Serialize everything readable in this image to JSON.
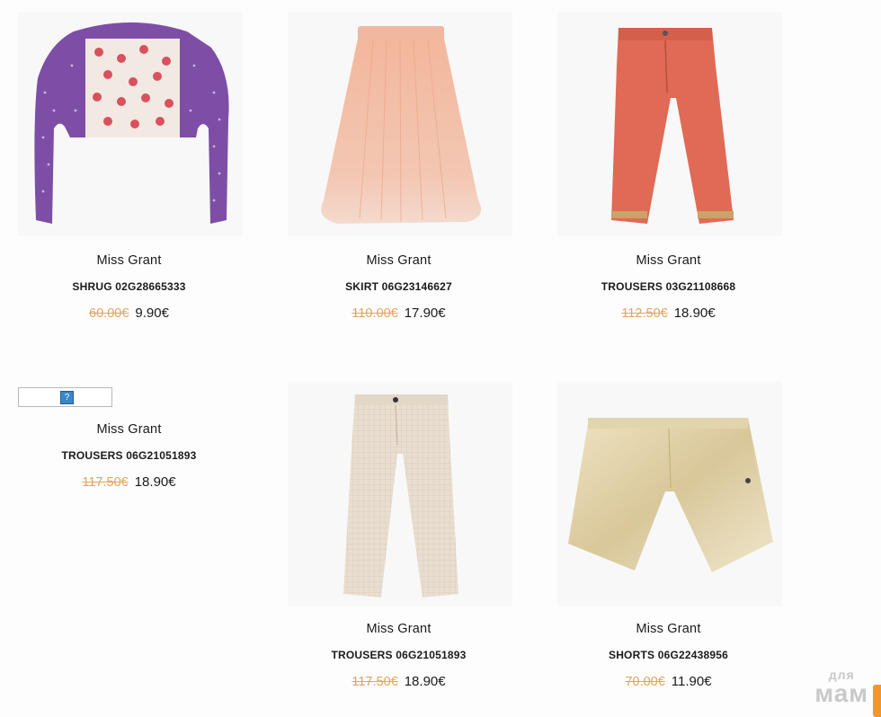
{
  "products": [
    {
      "brand": "Miss Grant",
      "title": "SHRUG 02G28665333",
      "old_price": "60.00€",
      "new_price": "9.90€",
      "image": "purple-polka-dot-shrug"
    },
    {
      "brand": "Miss Grant",
      "title": "SKIRT 06G23146627",
      "old_price": "110.00€",
      "new_price": "17.90€",
      "image": "peach-tulle-skirt"
    },
    {
      "brand": "Miss Grant",
      "title": "TROUSERS 03G21108668",
      "old_price": "112.50€",
      "new_price": "18.90€",
      "image": "coral-trousers"
    },
    {
      "brand": "Miss Grant",
      "title": "TROUSERS 06G21051893",
      "old_price": "117.50€",
      "new_price": "18.90€",
      "image": "broken-image"
    },
    {
      "brand": "Miss Grant",
      "title": "TROUSERS 06G21051893",
      "old_price": "117.50€",
      "new_price": "18.90€",
      "image": "cream-check-trousers"
    },
    {
      "brand": "Miss Grant",
      "title": "SHORTS 06G22438956",
      "old_price": "70.00€",
      "new_price": "11.90€",
      "image": "gold-shorts"
    }
  ],
  "broken_image_glyph": "?",
  "watermark": {
    "line1": "для",
    "line2": "мам"
  },
  "colors": {
    "old_price": "#e5a35c",
    "accent_tab": "#f0962f"
  }
}
